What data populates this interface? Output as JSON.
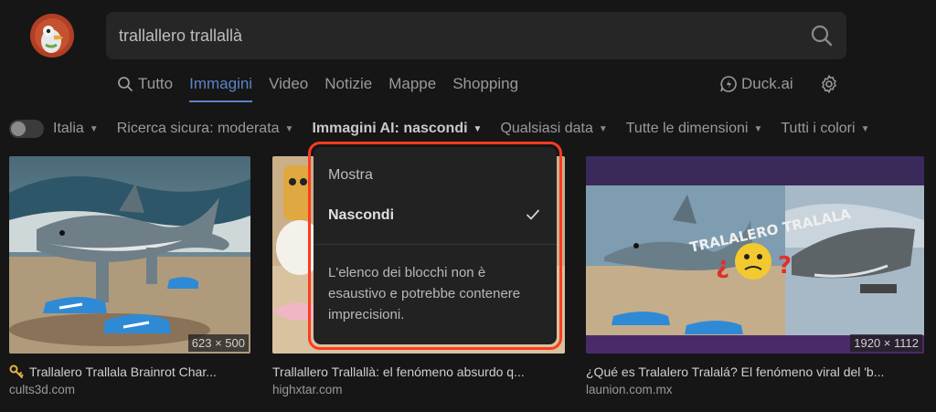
{
  "search": {
    "query": "trallallero trallallà"
  },
  "tabs": [
    {
      "label": "Tutto"
    },
    {
      "label": "Immagini"
    },
    {
      "label": "Video"
    },
    {
      "label": "Notizie"
    },
    {
      "label": "Mappe"
    },
    {
      "label": "Shopping"
    }
  ],
  "header": {
    "duck_ai": "Duck.ai"
  },
  "filters": {
    "region": "Italia",
    "safe_search": "Ricerca sicura: moderata",
    "ai_images": "Immagini AI: nascondi",
    "date": "Qualsiasi data",
    "size": "Tutte le dimensioni",
    "color": "Tutti i colori"
  },
  "dropdown": {
    "option_show": "Mostra",
    "option_hide": "Nascondi",
    "note": "L'elenco dei blocchi non è esaustivo e potrebbe contenere imprecisioni."
  },
  "results": [
    {
      "title": "Trallalero Trallala Brainrot Char...",
      "domain": "cults3d.com",
      "dims": "623 × 500"
    },
    {
      "title": "Trallallero Trallallà: el fenómeno absurdo q...",
      "domain": "highxtar.com",
      "dims": ""
    },
    {
      "title": "¿Qué es Tralalero Tralalá? El fenómeno viral del 'b...",
      "domain": "launion.com.mx",
      "dims": "1920 × 1112"
    }
  ],
  "image_text": {
    "banner": "TRALALERO TRALALA"
  },
  "colors": {
    "accent": "#5a83c9",
    "highlight": "#ff3b1f",
    "background": "#161616"
  }
}
